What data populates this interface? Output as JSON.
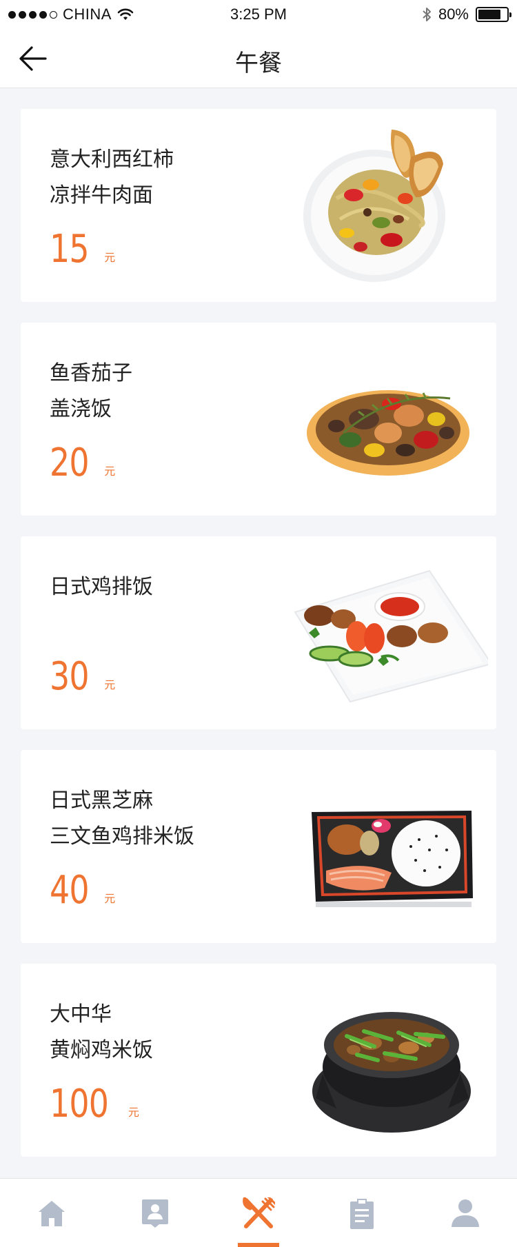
{
  "status_bar": {
    "carrier": "CHINA",
    "time": "3:25 PM",
    "battery_text": "80%",
    "battery_level": 0.8,
    "signal_bars_filled": 4,
    "signal_bars_total": 5
  },
  "nav": {
    "title": "午餐",
    "back_icon": "arrow-left-icon"
  },
  "menu": {
    "items": [
      {
        "name_line1": "意大利西红柿",
        "name_line2": "凉拌牛肉面",
        "price": "15",
        "unit": "元",
        "image": "pasta-salad-plate"
      },
      {
        "name_line1": "鱼香茄子",
        "name_line2": "盖浇饭",
        "price": "20",
        "unit": "元",
        "image": "eggplant-stir-fry"
      },
      {
        "name_line1": "日式鸡排饭",
        "name_line2": "",
        "price": "30",
        "unit": "元",
        "image": "chicken-skewer-plate"
      },
      {
        "name_line1": "日式黑芝麻",
        "name_line2": "三文鱼鸡排米饭",
        "price": "40",
        "unit": "元",
        "image": "salmon-bento-box"
      },
      {
        "name_line1": "大中华",
        "name_line2": "黄焖鸡米饭",
        "price": "100",
        "unit": "元",
        "image": "braised-chicken-claypot"
      }
    ]
  },
  "tab_bar": {
    "active_index": 2,
    "tabs": [
      {
        "icon": "home-icon"
      },
      {
        "icon": "contact-card-icon"
      },
      {
        "icon": "fork-knife-icon"
      },
      {
        "icon": "clipboard-icon"
      },
      {
        "icon": "user-icon"
      }
    ]
  },
  "colors": {
    "accent": "#ef7431",
    "tab_inactive": "#b2bccb",
    "background": "#f4f5f8",
    "card": "#ffffff",
    "text": "#222222"
  }
}
